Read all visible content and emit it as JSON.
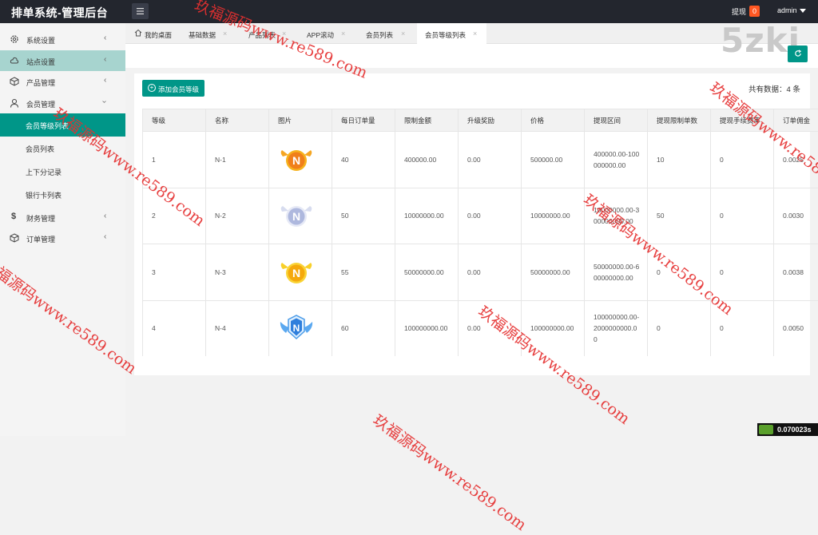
{
  "app": {
    "title": "排单系统-管理后台"
  },
  "topbar": {
    "withdraw_label": "提现",
    "withdraw_count": "0",
    "user": "admin"
  },
  "sidebar": {
    "items": [
      {
        "label": "系统设置",
        "icon": "gear-icon"
      },
      {
        "label": "站点设置",
        "icon": "site-icon"
      },
      {
        "label": "产品管理",
        "icon": "box-icon"
      },
      {
        "label": "会员管理",
        "icon": "user-icon"
      }
    ],
    "sub_items": [
      "会员等级列表",
      "会员列表",
      "上下分记录",
      "银行卡列表"
    ],
    "bottom_items": [
      {
        "label": "财务管理",
        "icon": "dollar-icon"
      },
      {
        "label": "订单管理",
        "icon": "box-icon"
      }
    ]
  },
  "tabs": [
    {
      "label": "我的桌面",
      "icon": "home-icon"
    },
    {
      "label": "基础数据"
    },
    {
      "label": "产品列表"
    },
    {
      "label": "APP滚动"
    },
    {
      "label": "会员列表"
    },
    {
      "label": "会员等级列表"
    }
  ],
  "tab_close": "×",
  "brand": "5zki",
  "page": {
    "add_button": "添加会员等级",
    "total": "共有数据：4 条"
  },
  "table": {
    "headers": [
      "等级",
      "名称",
      "图片",
      "每日订单量",
      "限制金额",
      "升级奖励",
      "价格",
      "提现区间",
      "提现限制单数",
      "提现手续费率",
      "订单佣金"
    ],
    "rows": [
      {
        "level": "1",
        "name": "N-1",
        "daily_orders": "40",
        "limit": "400000.00",
        "bonus": "0.00",
        "price": "500000.00",
        "range": "400000.00-100000000.00",
        "withdraw_count": "10",
        "fee": "0",
        "commission": "0.0025"
      },
      {
        "level": "2",
        "name": "N-2",
        "daily_orders": "50",
        "limit": "10000000.00",
        "bonus": "0.00",
        "price": "10000000.00",
        "range": "10000000.00-300000000.00",
        "withdraw_count": "50",
        "fee": "0",
        "commission": "0.0030"
      },
      {
        "level": "3",
        "name": "N-3",
        "daily_orders": "55",
        "limit": "50000000.00",
        "bonus": "0.00",
        "price": "50000000.00",
        "range": "50000000.00-600000000.00",
        "withdraw_count": "0",
        "fee": "0",
        "commission": "0.0038"
      },
      {
        "level": "4",
        "name": "N-4",
        "daily_orders": "60",
        "limit": "100000000.00",
        "bonus": "0.00",
        "price": "100000000.00",
        "range": "100000000.00-2000000000.00",
        "withdraw_count": "0",
        "fee": "0",
        "commission": "0.0050"
      }
    ]
  },
  "timer": "0.070023s",
  "watermark": "玖福源码www.re589.com",
  "colors": {
    "accent": "#009688",
    "topbar": "#23262e",
    "badge": "#ff5722",
    "watermark": "#e53030"
  }
}
